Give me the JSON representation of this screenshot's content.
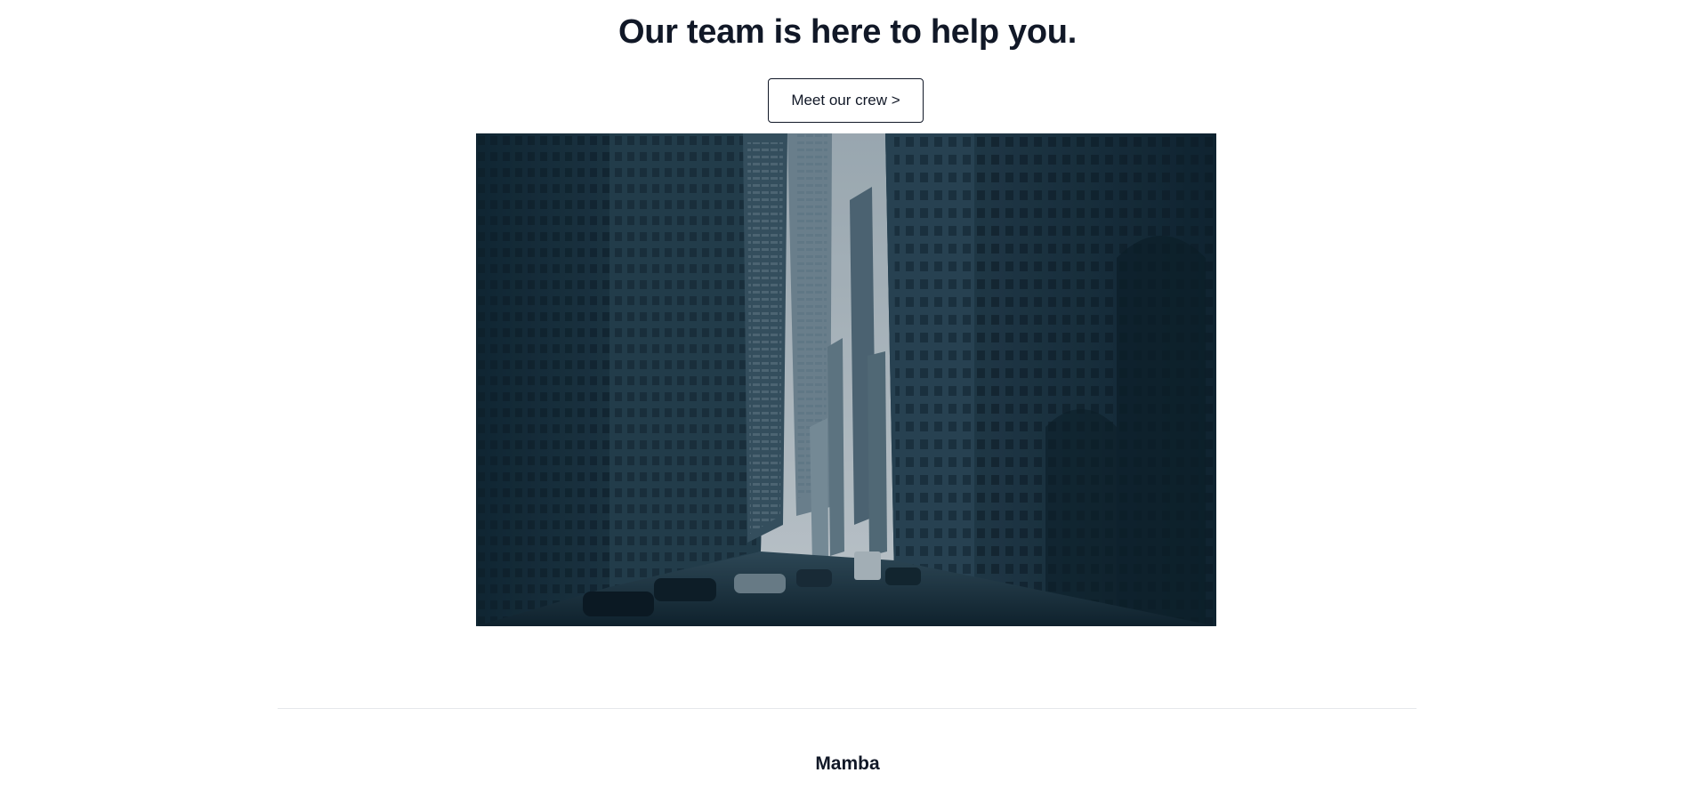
{
  "hero_section": {
    "heading": "Our team is here to help you.",
    "cta_label": "Meet our crew >"
  },
  "hero_image": {
    "subject": "city-street-skyscrapers-photo",
    "palette": {
      "sky": "#c9d3d8",
      "shadow": "#0f2430",
      "building_dark": "#18323f",
      "building_mid": "#2b4756",
      "building_light": "#4d6878",
      "street": "#1a2e38"
    }
  },
  "footer": {
    "brand_name": "Mamba",
    "divider_color": "#e5e7eb"
  },
  "colors": {
    "text": "#111827",
    "background": "#ffffff"
  }
}
